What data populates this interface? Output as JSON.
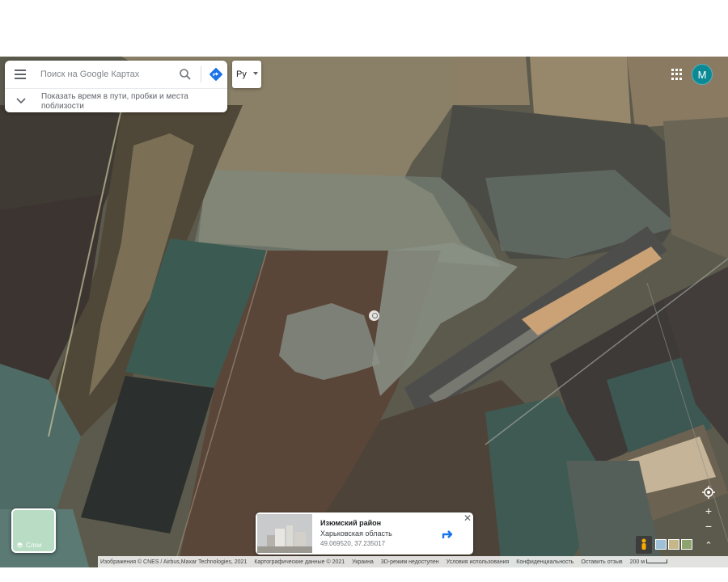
{
  "search": {
    "placeholder": "Поиск на Google Картах",
    "hint": "Показать время в пути, пробки и места поблизости"
  },
  "language_button": "Ру",
  "account": {
    "avatar_letter": "M"
  },
  "place_card": {
    "title": "Изюмский район",
    "subtitle": "Харьковская область",
    "coordinates": "49.069520, 37.235017",
    "close_glyph": "✕"
  },
  "layers": {
    "label": "Слои"
  },
  "controls": {
    "zoom_in": "+",
    "zoom_out": "−",
    "expand_glyph": "⌃"
  },
  "attribution": {
    "imagery": "Изображения © CNES / Airbus,Maxar Technologies, 2021",
    "map_data": "Картографические данные © 2021",
    "country": "Украина",
    "mode_3d": "3D-режим недоступен",
    "terms": "Условия использования",
    "privacy": "Конфиденциальность",
    "feedback": "Оставить отзыв",
    "scale": "200 м"
  },
  "icons": {
    "menu": "menu-icon",
    "search": "search-icon",
    "directions": "directions-icon",
    "chevron": "chevron-down-icon",
    "apps": "apps-grid-icon",
    "layers": "layers-icon",
    "locate": "my-location-icon",
    "pegman": "pegman-icon",
    "pin": "location-pin-icon"
  },
  "colors": {
    "directions_blue": "#1a73e8",
    "avatar_teal": "#0b8a96"
  }
}
